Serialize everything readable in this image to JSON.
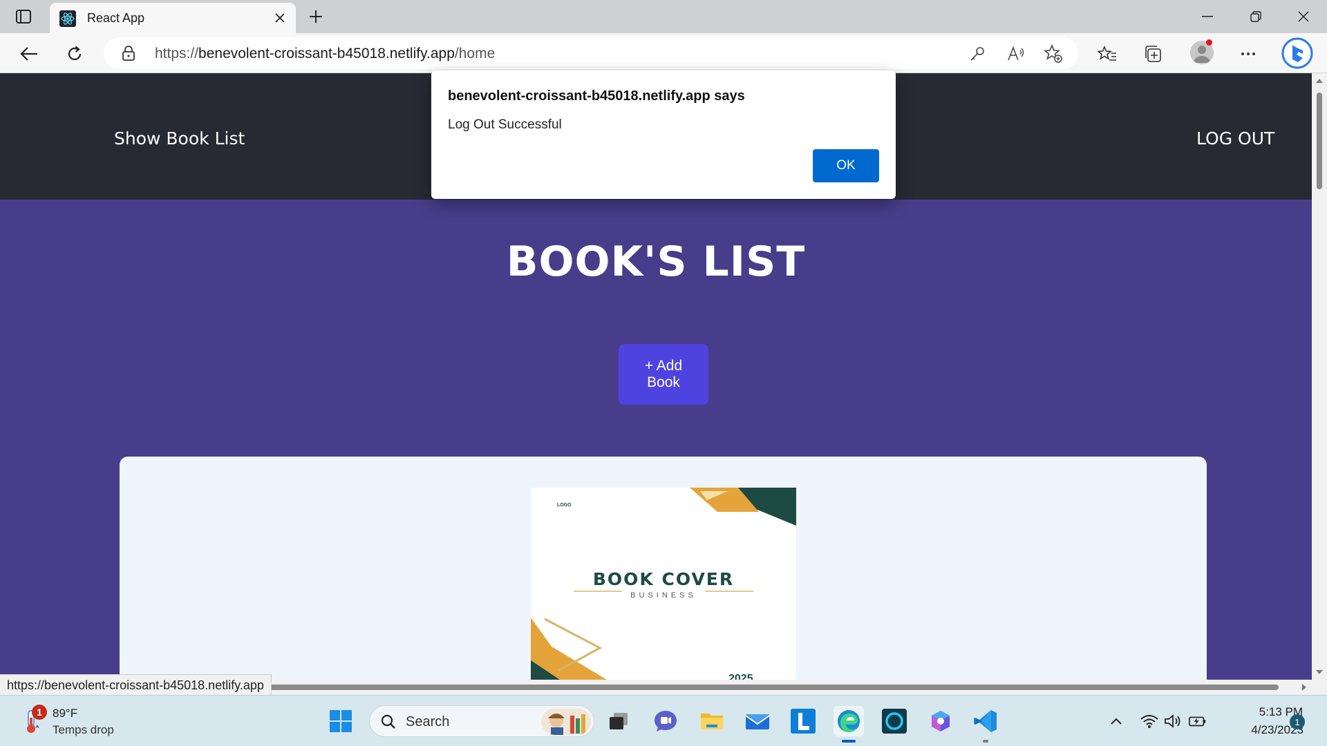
{
  "browser": {
    "tab_title": "React App",
    "url_scheme": "https://",
    "url_host": "benevolent-croissant-b45018.netlify.app",
    "url_path": "/home",
    "status_url": "https://benevolent-croissant-b45018.netlify.app"
  },
  "navbar": {
    "left_link": "Show Book List",
    "right_link": "LOG OUT"
  },
  "main": {
    "heading": "BOOK'S LIST",
    "add_button": "+ Add Book"
  },
  "book_card": {
    "cover_logo": "LOGO",
    "cover_title": "BOOK COVER",
    "cover_subtitle": "BUSINESS",
    "cover_year": "2025"
  },
  "dialog": {
    "title": "benevolent-croissant-b45018.netlify.app says",
    "message": "Log Out Successful",
    "ok_label": "OK"
  },
  "taskbar": {
    "weather_badge": "1",
    "weather_temp": "89°F",
    "weather_desc": "Temps drop",
    "search_label": "Search",
    "time": "5:13 PM",
    "date": "4/23/2023",
    "notification_count": "1",
    "apps": [
      "windows-start",
      "task-view",
      "teams-chat",
      "file-explorer",
      "mail",
      "lexicon-l",
      "edge",
      "alexa",
      "copilot",
      "vs-code"
    ]
  },
  "colors": {
    "page_bg": "#483d8b",
    "navbar_bg": "#272a33",
    "add_button_bg": "#4f43e0",
    "card_bg": "#eff5fd",
    "dialog_ok_bg": "#0069cf"
  }
}
